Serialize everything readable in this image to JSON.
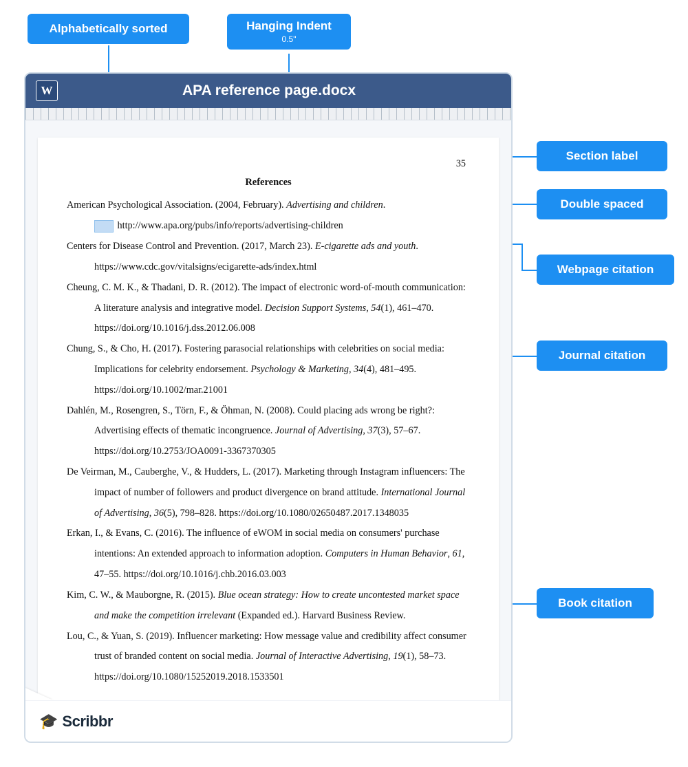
{
  "callouts": {
    "alpha_sorted": "Alphabetically sorted",
    "hanging_indent": "Hanging Indent",
    "hanging_indent_sub": "0.5\"",
    "section_label": "Section label",
    "double_spaced": "Double spaced",
    "webpage_citation": "Webpage citation",
    "journal_citation": "Journal citation",
    "book_citation": "Book citation"
  },
  "doc": {
    "word_letter": "W",
    "title": "APA reference page.docx",
    "page_number": "35",
    "heading": "References",
    "refs": {
      "r1a": "American Psychological Association. (2004, February). ",
      "r1b": "Advertising and children",
      "r1c": ".",
      "r1d": "http://www.apa.org/pubs/info/reports/advertising-children",
      "r2a": "Centers for Disease Control and Prevention. (2017, March 23). ",
      "r2b": "E-cigarette ads and youth",
      "r2c": ".",
      "r2d": "https://www.cdc.gov/vitalsigns/ecigarette-ads/index.html",
      "r3a": "Cheung, C. M. K., & Thadani, D. R. (2012). The impact of electronic word-of-mouth communication: A literature analysis and integrative model. ",
      "r3b": "Decision Support Systems",
      "r3c": ", ",
      "r3d": "54",
      "r3e": "(1), 461–470. https://doi.org/10.1016/j.dss.2012.06.008",
      "r4a": "Chung, S., & Cho, H. (2017). Fostering parasocial relationships with celebrities on social media: Implications for celebrity endorsement. ",
      "r4b": "Psychology & Marketing",
      "r4c": ", ",
      "r4d": "34",
      "r4e": "(4), 481–495. https://doi.org/10.1002/mar.21001",
      "r5a": "Dahlén, M., Rosengren, S., Törn, F., & Öhman, N. (2008). Could placing ads wrong be right?: Advertising effects of thematic incongruence. ",
      "r5b": "Journal of Advertising",
      "r5c": ", ",
      "r5d": "37",
      "r5e": "(3), 57–67. https://doi.org/10.2753/JOA0091-3367370305",
      "r6a": "De Veirman, M., Cauberghe, V., & Hudders, L. (2017). Marketing through Instagram influencers: The impact of number of followers and product divergence on brand attitude. ",
      "r6b": "International Journal of Advertising",
      "r6c": ", ",
      "r6d": "36",
      "r6e": "(5), 798–828. https://doi.org/10.1080/02650487.2017.1348035",
      "r7a": "Erkan, I., & Evans, C. (2016). The influence of eWOM in social media on consumers' purchase intentions: An extended approach to information adoption. ",
      "r7b": "Computers in Human Behavior",
      "r7c": ", ",
      "r7d": "61",
      "r7e": ", 47–55. https://doi.org/10.1016/j.chb.2016.03.003",
      "r8a": "Kim, C. W., & Mauborgne, R. (2015). ",
      "r8b": "Blue ocean strategy: How to create uncontested market space and make the competition irrelevant",
      "r8c": " (Expanded ed.). Harvard Business Review.",
      "r9a": "Lou, C., & Yuan, S. (2019). Influencer marketing: How message value and credibility affect consumer trust of branded content on social media. ",
      "r9b": "Journal of Interactive Advertising",
      "r9c": ", ",
      "r9d": "19",
      "r9e": "(1), 58–73. https://doi.org/10.1080/15252019.2018.1533501"
    }
  },
  "logo": {
    "text": "Scribbr"
  }
}
